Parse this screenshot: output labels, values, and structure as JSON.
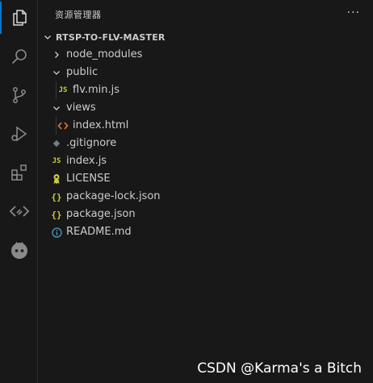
{
  "activity_bar": {
    "items": [
      {
        "name": "explorer-icon",
        "active": true
      },
      {
        "name": "search-icon",
        "active": false
      },
      {
        "name": "source-control-icon",
        "active": false
      },
      {
        "name": "run-debug-icon",
        "active": false
      },
      {
        "name": "extensions-icon",
        "active": false
      },
      {
        "name": "remote-icon",
        "active": false
      },
      {
        "name": "copilot-icon",
        "active": false
      }
    ],
    "accent_color": "#0078d4"
  },
  "sidebar": {
    "title": "资源管理器",
    "more_actions": "···",
    "section_label": "RTSP-TO-FLV-MASTER",
    "tree": [
      {
        "label": "node_modules",
        "type": "folder",
        "expanded": false,
        "depth": 0
      },
      {
        "label": "public",
        "type": "folder",
        "expanded": true,
        "depth": 0
      },
      {
        "label": "flv.min.js",
        "type": "js",
        "depth": 1,
        "icon_text": "JS"
      },
      {
        "label": "views",
        "type": "folder",
        "expanded": true,
        "depth": 0
      },
      {
        "label": "index.html",
        "type": "html",
        "depth": 1,
        "icon_text": "<>"
      },
      {
        "label": ".gitignore",
        "type": "gitignore",
        "depth": 0
      },
      {
        "label": "index.js",
        "type": "js",
        "depth": 0,
        "icon_text": "JS"
      },
      {
        "label": "LICENSE",
        "type": "license",
        "depth": 0
      },
      {
        "label": "package-lock.json",
        "type": "json",
        "depth": 0,
        "icon_text": "{}"
      },
      {
        "label": "package.json",
        "type": "json",
        "depth": 0,
        "icon_text": "{}"
      },
      {
        "label": "README.md",
        "type": "info",
        "depth": 0
      }
    ],
    "colors": {
      "js": "#cbcb41",
      "html": "#e37933",
      "license": "#cbcb41",
      "info": "#519aba",
      "gitignore": "#6d8086"
    }
  },
  "watermark": "CSDN @Karma's a Bitch"
}
